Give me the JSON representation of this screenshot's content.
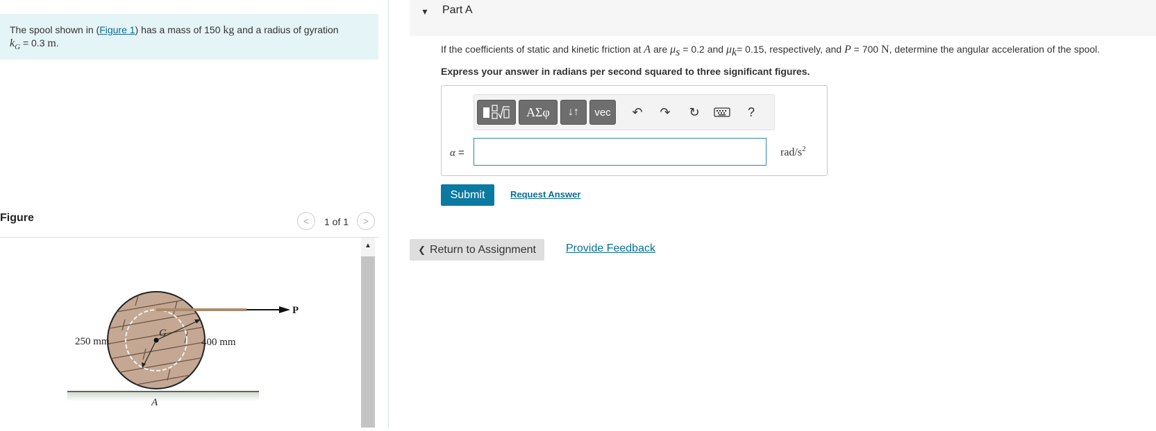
{
  "problem": {
    "text_before_link": "The spool shown in (",
    "figure_link": "Figure 1",
    "text_after_link": ") has a mass of 150 ",
    "mass_unit": "kg",
    "text_mid": " and a radius of gyration",
    "gyration_symbol": "k",
    "gyration_subscript": "G",
    "gyration_value": " = 0.3 ",
    "gyration_unit": "m",
    "end": "."
  },
  "figure_panel": {
    "title": "Figure",
    "counter": "1 of 1",
    "prev_icon": "chevron-left-icon",
    "next_icon": "chevron-right-icon",
    "prev_glyph": "<",
    "next_glyph": ">",
    "scroll_up_glyph": "▲",
    "labels": {
      "inner_radius": "250 mm",
      "center": "G",
      "outer_radius": "400 mm",
      "force": "P",
      "contact": "A"
    }
  },
  "part": {
    "toggle_glyph": "▼",
    "title": "Part A"
  },
  "question": {
    "t1": "If the coefficients of static and kinetic friction at ",
    "point": "A",
    "t2": " are ",
    "mu": "μ",
    "mu_s_sub": "s",
    "t3": " = 0.2 and ",
    "mu_k_sub": "k",
    "t4": "= 0.15, respectively, and ",
    "force": "P",
    "t5": " = 700 ",
    "force_unit": "N",
    "t6": ", determine the angular acceleration of the spool."
  },
  "instruction": "Express your answer in radians per second squared to three significant figures.",
  "toolbar": {
    "greek_label": "ΑΣφ",
    "arrows_label": "↓↑",
    "vec_label": "vec",
    "undo_glyph": "↶",
    "redo_glyph": "↷",
    "reset_glyph": "↻",
    "help_label": "?"
  },
  "answer": {
    "variable": "α",
    "equals": " =",
    "value": "",
    "unit": "rad/s",
    "unit_exponent": "2"
  },
  "actions": {
    "submit": "Submit",
    "request_answer": "Request Answer",
    "return_glyph": "❮",
    "return": "Return to Assignment",
    "feedback": "Provide Feedback"
  },
  "colors": {
    "problem_bg": "#e5f4f6",
    "link": "#0a6e99",
    "submit_bg": "#0b7aa1",
    "input_border": "#2a8a9f"
  }
}
